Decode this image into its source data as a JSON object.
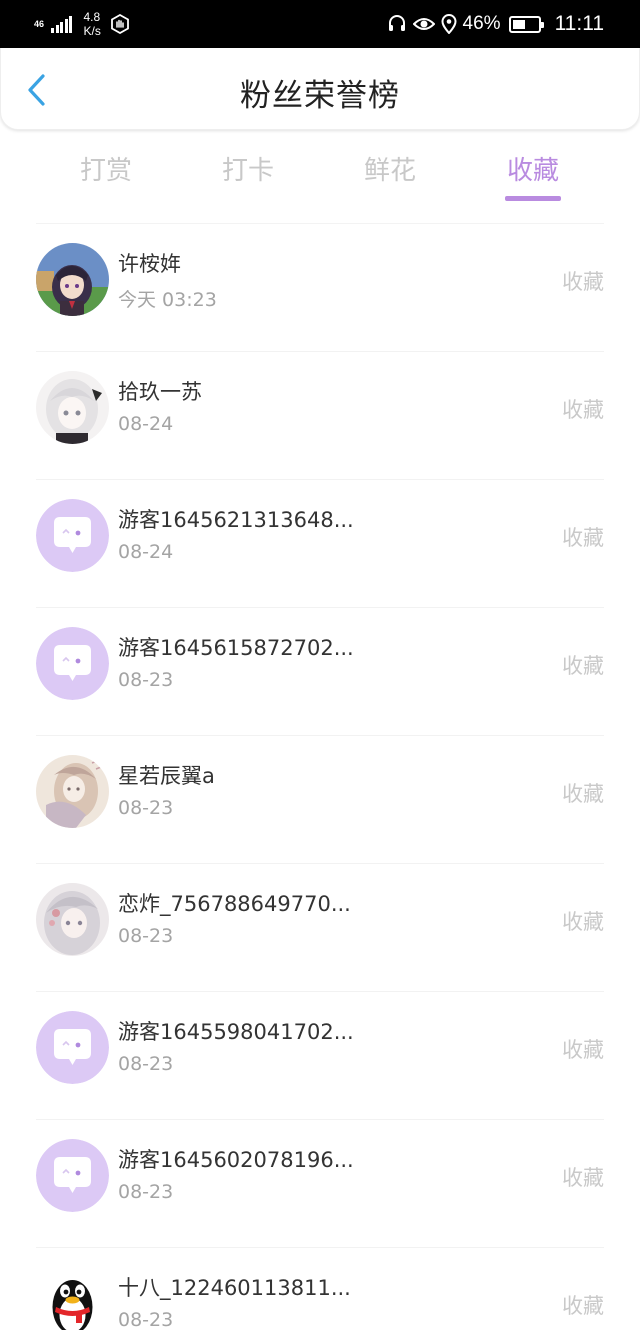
{
  "status_bar": {
    "network_type": "4G",
    "network_type_sub": "46",
    "net_speed_value": "4.8",
    "net_speed_unit": "K/s",
    "battery_percent": "46%",
    "battery_level": 0.46,
    "time": "11:11"
  },
  "header": {
    "title": "粉丝荣誉榜"
  },
  "tabs": [
    {
      "label": "打赏"
    },
    {
      "label": "打卡"
    },
    {
      "label": "鲜花"
    },
    {
      "label": "收藏"
    }
  ],
  "active_tab_index": 3,
  "colors": {
    "accent": "#b98be0",
    "inactive_tab": "#c8c8c8",
    "back_arrow": "#3aa3e3"
  },
  "fans": [
    {
      "name": "许桉姩",
      "date": "今天 03:23",
      "action": "收藏",
      "avatar": "anime-girl-avatar"
    },
    {
      "name": "拾玖一苏",
      "date": "08-24",
      "action": "收藏",
      "avatar": "white-hair-avatar"
    },
    {
      "name": "游客1645621313648...",
      "date": "08-24",
      "action": "收藏",
      "avatar": "guest-avatar"
    },
    {
      "name": "游客1645615872702...",
      "date": "08-23",
      "action": "收藏",
      "avatar": "guest-avatar"
    },
    {
      "name": "星若辰翼a",
      "date": "08-23",
      "action": "收藏",
      "avatar": "sketch-girl-avatar"
    },
    {
      "name": "恋炸_756788649770...",
      "date": "08-23",
      "action": "收藏",
      "avatar": "silver-hair-avatar"
    },
    {
      "name": "游客1645598041702...",
      "date": "08-23",
      "action": "收藏",
      "avatar": "guest-avatar"
    },
    {
      "name": "游客1645602078196...",
      "date": "08-23",
      "action": "收藏",
      "avatar": "guest-avatar"
    },
    {
      "name": "十八_122460113811...",
      "date": "08-23",
      "action": "收藏",
      "avatar": "qq-penguin-avatar"
    }
  ]
}
